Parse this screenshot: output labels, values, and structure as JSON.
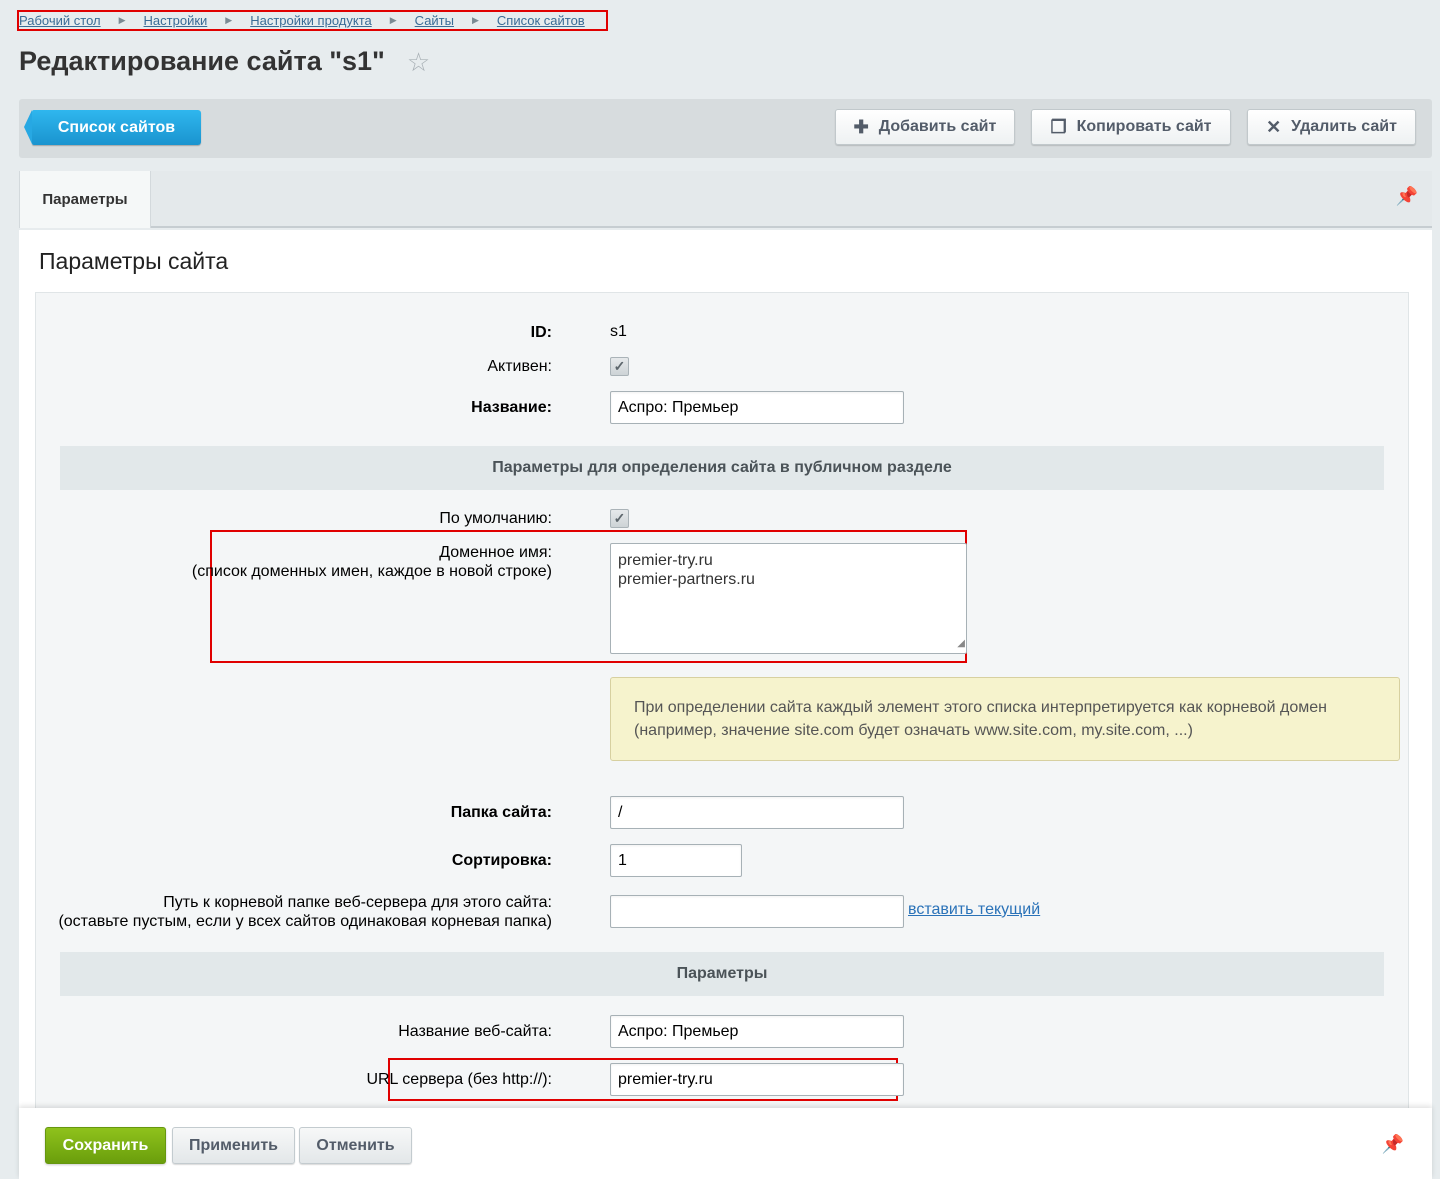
{
  "breadcrumb": [
    "Рабочий стол",
    "Настройки",
    "Настройки продукта",
    "Сайты",
    "Список сайтов"
  ],
  "title": "Редактирование сайта \"s1\"",
  "toolbar": {
    "back_label": "Список сайтов",
    "add_label": "Добавить сайт",
    "copy_label": "Копировать сайт",
    "delete_label": "Удалить сайт"
  },
  "tabs": [
    "Параметры"
  ],
  "panel_title": "Параметры сайта",
  "form": {
    "id_label": "ID:",
    "id_value": "s1",
    "active_label": "Активен:",
    "name_label": "Название:",
    "name_value": "Аспро: Премьер",
    "section1": "Параметры для определения сайта в публичном разделе",
    "default_label": "По умолчанию:",
    "domain_label": "Доменное имя:",
    "domain_hint": "(список доменных имен, каждое в новой строке)",
    "domains": [
      "premier-try.ru",
      "premier-partners.ru"
    ],
    "notice_line1": "При определении сайта каждый элемент этого списка интерпретируется как корневой домен",
    "notice_line2": "(например, значение site.com будет означать www.site.com, my.site.com, ...)",
    "folder_label": "Папка сайта:",
    "folder_value": "/",
    "sort_label": "Сортировка:",
    "sort_value": "1",
    "docroot_label": "Путь к корневой папке веб-сервера для этого сайта:",
    "docroot_hint": "(оставьте пустым, если у всех сайтов одинаковая корневая папка)",
    "docroot_value": "",
    "docroot_link": "вставить текущий",
    "section2": "Параметры",
    "sitename_label": "Название веб-сайта:",
    "sitename_value": "Аспро: Премьер",
    "url_label": "URL сервера (без http://):",
    "url_value": "premier-try.ru"
  },
  "footer": {
    "save": "Сохранить",
    "apply": "Применить",
    "cancel": "Отменить"
  },
  "colors": {
    "primary_blue": "#1a94cf",
    "save_green": "#7bb015",
    "highlight_red": "#e00000"
  }
}
